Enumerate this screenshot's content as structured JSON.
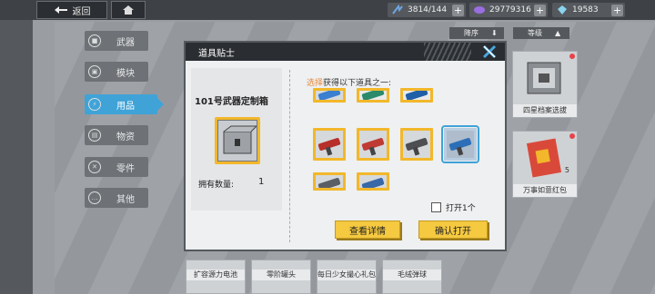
{
  "topbar": {
    "back_label": "返回",
    "resources": [
      {
        "icon": "energy-icon",
        "value": "3814/144",
        "color": "#6ea6e0"
      },
      {
        "icon": "gem-icon",
        "value": "29779316",
        "color": "#9a6ee0"
      },
      {
        "icon": "diamond-icon",
        "value": "19583",
        "color": "#8ad4ee"
      }
    ]
  },
  "nav": {
    "items": [
      {
        "label": "武器",
        "icon": "weapon-icon"
      },
      {
        "label": "模块",
        "icon": "module-icon"
      },
      {
        "label": "用品",
        "icon": "bolt-icon",
        "active": true
      },
      {
        "label": "物资",
        "icon": "supply-icon"
      },
      {
        "label": "零件",
        "icon": "parts-icon"
      },
      {
        "label": "其他",
        "icon": "other-icon"
      }
    ]
  },
  "sort": {
    "order_label": "降序",
    "grade_label": "等级"
  },
  "right_cards": [
    {
      "label": "四星档案选拔",
      "icon": "package-icon"
    },
    {
      "label": "万事如意红包",
      "icon": "red-packet-icon",
      "count": "5"
    }
  ],
  "bottom_cards": [
    {
      "label": "扩容源力电池"
    },
    {
      "label": "零阶罐头"
    },
    {
      "label": "每日少女撮心礼包"
    },
    {
      "label": "毛绒弹球"
    }
  ],
  "dialog": {
    "title": "道具贴士",
    "box_name": "101号武器定制箱",
    "owned_label": "拥有数量:",
    "owned_count": "1",
    "instruction_highlight": "选择",
    "instruction_rest": "获得以下道具之一:",
    "open_one_label": "打开1个",
    "details_button": "查看详情",
    "confirm_button": "确认打开",
    "items": [
      {
        "color": "#3a7fd0",
        "cut": true
      },
      {
        "color": "#2b8a6a",
        "cut": true
      },
      {
        "color": "#1f5fa8",
        "cut": true
      },
      {
        "color": "#b82f2a"
      },
      {
        "color": "#c03a34"
      },
      {
        "color": "#4d4f52"
      },
      {
        "color": "#2c6fb8",
        "selected": true
      },
      {
        "color": "#5a5f66",
        "cutb": true
      },
      {
        "color": "#3868a8",
        "cutb": true
      }
    ]
  }
}
